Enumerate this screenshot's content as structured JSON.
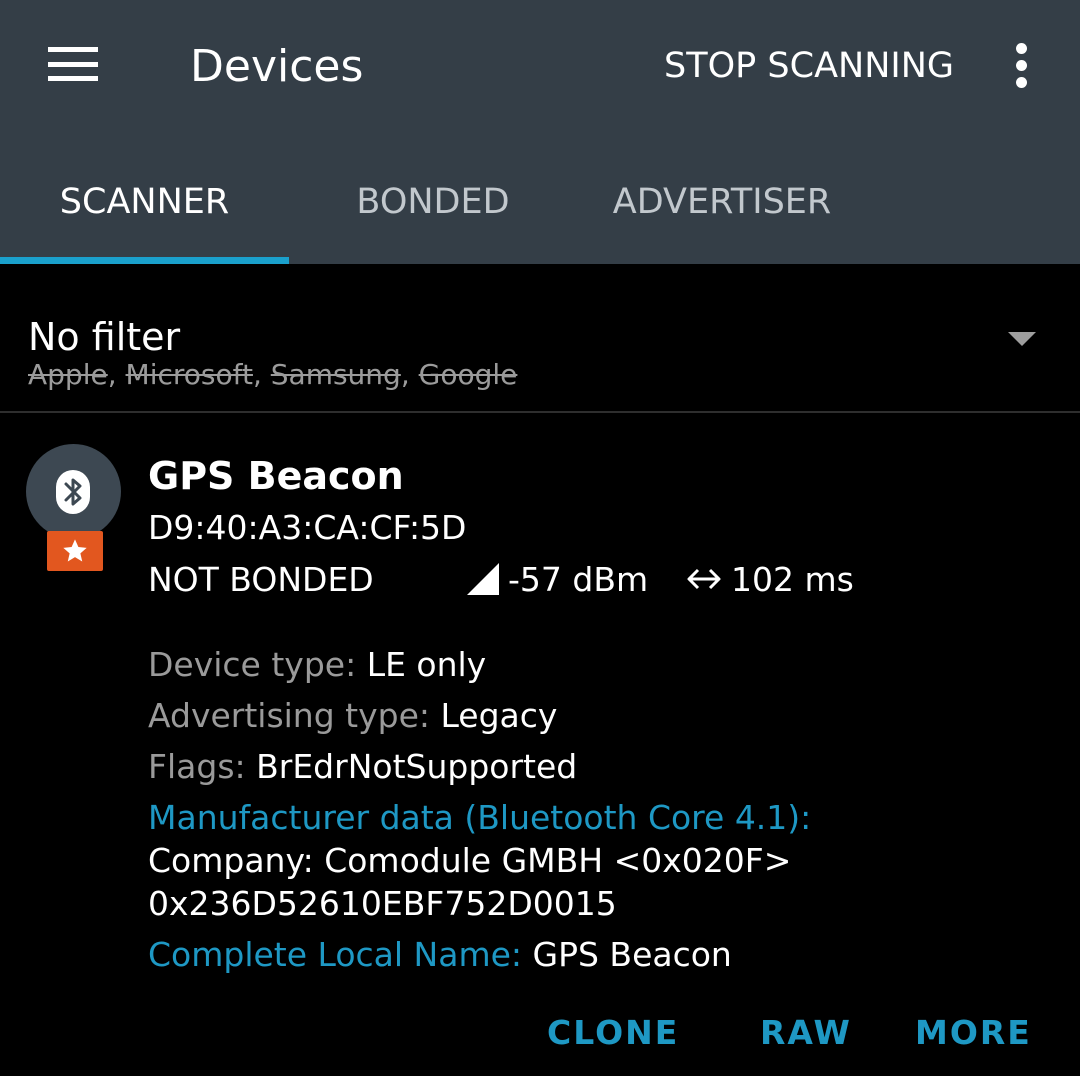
{
  "appbar": {
    "title": "Devices",
    "stop_scanning_label": "STOP SCANNING",
    "background": "#343e47"
  },
  "tabs": [
    {
      "label": "SCANNER",
      "active": true
    },
    {
      "label": "BONDED",
      "active": false
    },
    {
      "label": "ADVERTISER",
      "active": false
    }
  ],
  "accent_color": "#1aa0cc",
  "filter": {
    "title": "No filter",
    "excluded": [
      "Apple",
      "Microsoft",
      "Samsung",
      "Google"
    ],
    "separator": ", "
  },
  "device": {
    "icon": "bluetooth-icon",
    "favorite_icon": "star-icon",
    "name": "GPS Beacon",
    "address": "D9:40:A3:CA:CF:5D",
    "bond_state": "NOT BONDED",
    "rssi": "-57 dBm",
    "interval": "102 ms",
    "details": {
      "device_type_label": "Device type: ",
      "device_type_value": "LE only",
      "adv_type_label": "Advertising type: ",
      "adv_type_value": "Legacy",
      "flags_label": "Flags: ",
      "flags_value": "BrEdrNotSupported",
      "manufacturer_label": "Manufacturer data (Bluetooth Core 4.1):",
      "company_line": "Company: Comodule GMBH <0x020F>",
      "manufacturer_payload": "0x236D52610EBF752D0015",
      "local_name_label": "Complete Local Name: ",
      "local_name_value": "GPS Beacon"
    },
    "actions": {
      "clone": "CLONE",
      "raw": "RAW",
      "more": "MORE"
    }
  }
}
